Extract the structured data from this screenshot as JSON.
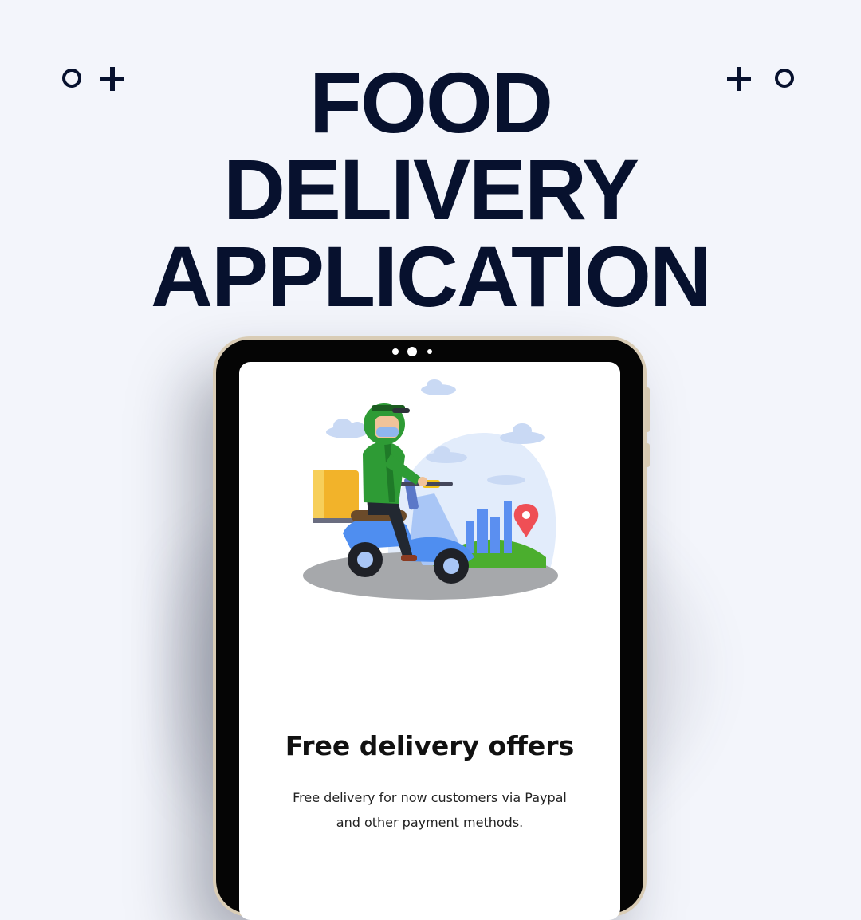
{
  "headline": {
    "line1": "FOOD",
    "line2": "DELIVERY",
    "line3": "APPLICATION"
  },
  "screen": {
    "offer_title": "Free delivery offers",
    "offer_text": "Free delivery for now customers via  Paypal and other payment methods."
  },
  "colors": {
    "background": "#f3f5fb",
    "title": "#07112e",
    "tablet_frame": "#050505",
    "tablet_rim": "#d9ccb5",
    "rider_jacket": "#2e9b35",
    "scooter": "#4f8ef0",
    "cargo_box": "#f2b32a",
    "map_pin": "#ef4f55"
  },
  "icons": [
    "circle-outline-icon",
    "plus-icon",
    "delivery-rider-illustration",
    "map-pin-icon"
  ]
}
